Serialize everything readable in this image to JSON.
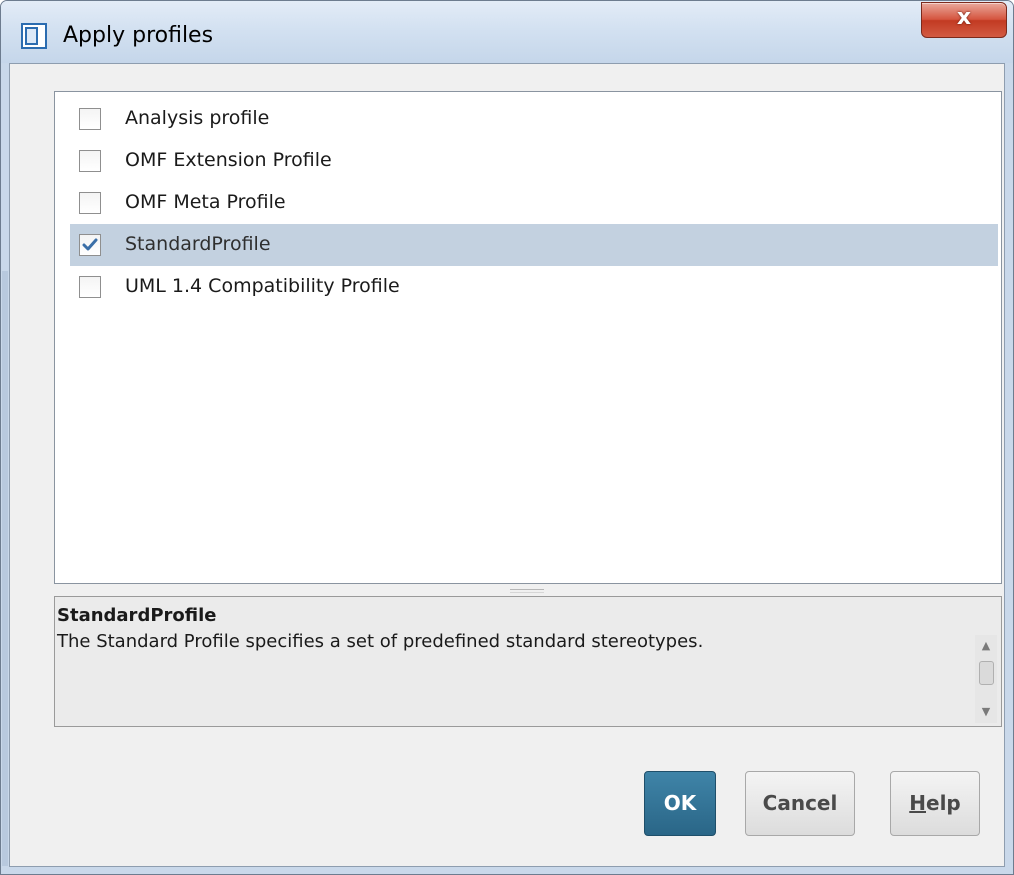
{
  "window": {
    "title": "Apply profiles",
    "close_symbol": "x"
  },
  "profiles": [
    {
      "label": "Analysis profile",
      "checked": false,
      "selected": false
    },
    {
      "label": "OMF Extension Profile",
      "checked": false,
      "selected": false
    },
    {
      "label": "OMF Meta Profile",
      "checked": false,
      "selected": false
    },
    {
      "label": "StandardProfile",
      "checked": true,
      "selected": true
    },
    {
      "label": "UML 1.4 Compatibility Profile",
      "checked": false,
      "selected": false
    }
  ],
  "description": {
    "title": "StandardProfile",
    "text": "The Standard Profile specifies a set of predefined standard stereotypes."
  },
  "buttons": {
    "ok_label": "OK",
    "cancel_label": "Cancel",
    "help_mnemonic": "H",
    "help_rest": "elp"
  },
  "icons": {
    "window_icon": "profile-window-icon",
    "close": "close-icon",
    "check": "checkmark-icon",
    "scroll_up": "scroll-up-arrow-icon",
    "scroll_down": "scroll-down-arrow-icon"
  },
  "colors": {
    "selection": "#c3d1e0",
    "ok_button": "#2a6687",
    "close_button": "#c23a22"
  }
}
